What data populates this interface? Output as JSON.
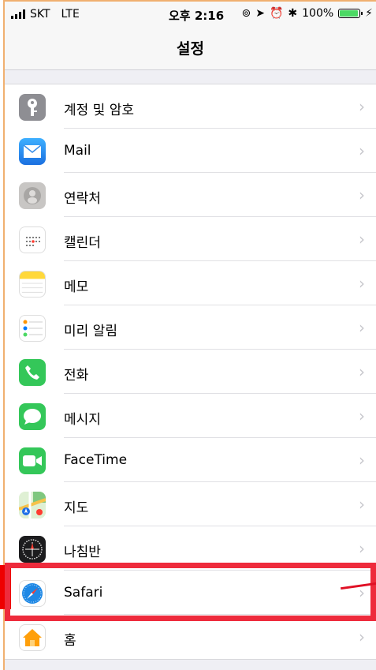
{
  "status_bar": {
    "carrier": "SKT",
    "network": "LTE",
    "time": "오후 2:16",
    "battery_percent": "100%",
    "battery_level": 1.0
  },
  "nav": {
    "title": "설정"
  },
  "settings": [
    {
      "label": "계정 및 암호",
      "icon": "key-icon",
      "color": "#8e8e93"
    },
    {
      "label": "Mail",
      "icon": "mail-icon",
      "color": "#1a8cf0"
    },
    {
      "label": "연락처",
      "icon": "contacts-icon",
      "color": "#c8c6c4"
    },
    {
      "label": "캘린더",
      "icon": "calendar-icon",
      "color": "#ffffff"
    },
    {
      "label": "메모",
      "icon": "notes-icon",
      "color": "#ffd83a"
    },
    {
      "label": "미리 알림",
      "icon": "reminders-icon",
      "color": "#ffffff"
    },
    {
      "label": "전화",
      "icon": "phone-icon",
      "color": "#34c759"
    },
    {
      "label": "메시지",
      "icon": "messages-icon",
      "color": "#34c759"
    },
    {
      "label": "FaceTime",
      "icon": "facetime-icon",
      "color": "#34c759"
    },
    {
      "label": "지도",
      "icon": "maps-icon",
      "color": "#6cc06c"
    },
    {
      "label": "나침반",
      "icon": "compass-icon",
      "color": "#1c1c1e"
    },
    {
      "label": "Safari",
      "icon": "safari-icon",
      "color": "#1e88e5"
    },
    {
      "label": "홈",
      "icon": "home-icon",
      "color": "#ff9f0a"
    }
  ],
  "annotation": {
    "highlight_color": "#ee2b3c"
  }
}
